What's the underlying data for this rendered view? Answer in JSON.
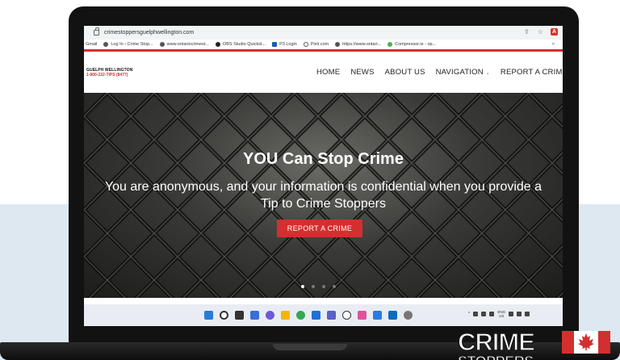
{
  "browser": {
    "url": "crimestoppersguelphwellington.com",
    "bookmarks": [
      {
        "label": "Gmail"
      },
      {
        "label": "Log In ‹ Crime Stop..."
      },
      {
        "label": "www.ontariocrimest..."
      },
      {
        "label": "OBS Studio Quickst..."
      },
      {
        "label": "P3 Login"
      },
      {
        "label": "Pixlr.com"
      },
      {
        "label": "https://www.ontari..."
      },
      {
        "label": "Compressor.io - op..."
      }
    ],
    "more": "»"
  },
  "site": {
    "logo_top": "GUELPH WELLINGTON",
    "logo_bottom": "1-800-222-TIPS (8477)",
    "nav": {
      "home": "HOME",
      "news": "NEWS",
      "about": "ABOUT US",
      "navigation": "NAVIGATION",
      "report": "REPORT A CRIME"
    },
    "accent_color": "#d32f2f"
  },
  "hero": {
    "title": "YOU Can Stop Crime",
    "subtitle": "You are anonymous, and your information is confidential when you provide a Tip to Crime Stoppers",
    "button": "REPORT A CRIME",
    "slides": 4,
    "active_slide": 1
  },
  "taskbar": {
    "icons": [
      "windows-start-icon",
      "search-icon",
      "task-view-icon",
      "widgets-icon",
      "chat-icon",
      "file-explorer-icon",
      "chrome-icon",
      "mail-icon",
      "teams-icon",
      "obs-icon",
      "photos-icon",
      "store-icon",
      "outlook-icon",
      "settings-icon"
    ],
    "lang_top": "ENG",
    "lang_bottom": "US"
  },
  "brand_logo": {
    "word1": "CRIME",
    "word2": "STOPPERS"
  }
}
